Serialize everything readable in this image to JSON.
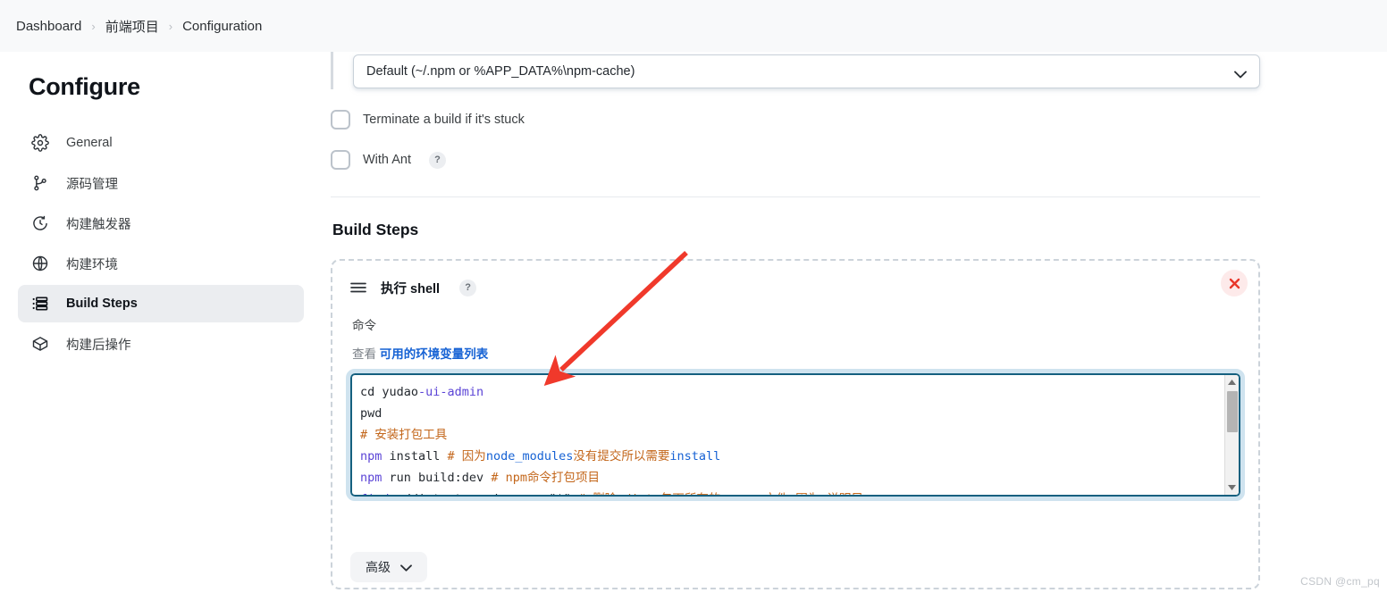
{
  "breadcrumb": {
    "items": [
      "Dashboard",
      "前端项目",
      "Configuration"
    ],
    "separator": "›"
  },
  "sidebar": {
    "title": "Configure",
    "items": [
      {
        "label": "General",
        "icon": "gear-icon",
        "active": false
      },
      {
        "label": "源码管理",
        "icon": "branch-icon",
        "active": false
      },
      {
        "label": "构建触发器",
        "icon": "clock-icon",
        "active": false
      },
      {
        "label": "构建环境",
        "icon": "globe-icon",
        "active": false
      },
      {
        "label": "Build Steps",
        "icon": "list-icon",
        "active": true
      },
      {
        "label": "构建后操作",
        "icon": "package-icon",
        "active": false
      }
    ]
  },
  "main": {
    "cache_select": {
      "value": "Default (~/.npm or %APP_DATA%\\npm-cache)",
      "icon": "chevron-down-icon"
    },
    "checkboxes": [
      {
        "label": "Terminate a build if it's stuck",
        "checked": false,
        "help": null
      },
      {
        "label": "With Ant",
        "checked": false,
        "help": "?"
      }
    ],
    "section_title": "Build Steps",
    "step": {
      "drag_icon": "hamburger-drag-icon",
      "title": "执行 shell",
      "help": "?",
      "close_icon": "close-icon",
      "command_label": "命令",
      "env_prefix": "查看",
      "env_link": "可用的环境变量列表",
      "advanced_label": "高级",
      "advanced_icon": "chevron-down-icon",
      "code_lines": [
        [
          {
            "t": "cd yudao",
            "c": "tok-plain"
          },
          {
            "t": "-ui",
            "c": "tok-kw"
          },
          {
            "t": "-admin",
            "c": "tok-kw"
          }
        ],
        [
          {
            "t": "pwd",
            "c": "tok-plain"
          }
        ],
        [
          {
            "t": "# 安装打包工具",
            "c": "tok-cmt"
          }
        ],
        [
          {
            "t": "npm",
            "c": "tok-kw"
          },
          {
            "t": " install ",
            "c": "tok-plain"
          },
          {
            "t": "# 因为",
            "c": "tok-cmt"
          },
          {
            "t": "node_modules",
            "c": "tok-str"
          },
          {
            "t": "没有提交所以需要",
            "c": "tok-cmt"
          },
          {
            "t": "install",
            "c": "tok-str"
          }
        ],
        [
          {
            "t": "npm",
            "c": "tok-kw"
          },
          {
            "t": " run build:dev ",
            "c": "tok-plain"
          },
          {
            "t": "# npm命令打包项目",
            "c": "tok-cmt"
          }
        ],
        [
          {
            "t": "find",
            "c": "tok-kw"
          },
          {
            "t": " ./dist -type d -name \"*\" ",
            "c": "tok-plain"
          },
          {
            "t": "# 删除 dist 包下所有的 .map 文件,因为 说明目...",
            "c": "tok-cmt"
          }
        ]
      ],
      "scrollbar": {
        "up_icon": "scroll-up-icon",
        "down_icon": "scroll-down-icon"
      }
    }
  },
  "annotation": {
    "arrow_color": "#f0392b"
  },
  "watermark": "CSDN @cm_pq",
  "colors": {
    "accent_link": "#1662d4",
    "editor_focus": "#15607f",
    "danger": "#e8372a",
    "sidebar_active_bg": "#ebedf0"
  }
}
